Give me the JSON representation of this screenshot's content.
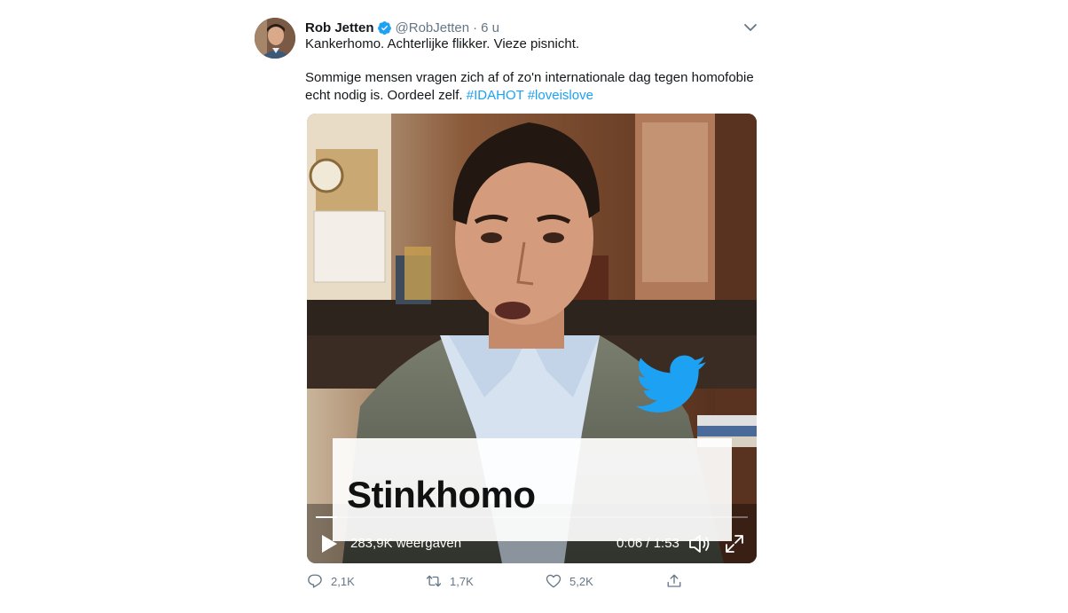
{
  "tweet": {
    "author_name": "Rob Jetten",
    "author_handle": "@RobJetten",
    "separator": "·",
    "time": "6 u",
    "text_line1": "Kankerhomo. Achterlijke flikker. Vieze pisnicht.",
    "text_line2": "Sommige mensen vragen zich af of zo'n internationale dag tegen homofobie echt nodig is. Oordeel zelf.",
    "hashtags": [
      "#IDAHOT",
      "#loveislove"
    ],
    "verified": true
  },
  "video": {
    "caption": "Stinkhomo",
    "views": "283,9K weergaven",
    "duration": "0:06 / 1:53",
    "progress": 0.05
  },
  "actions": {
    "replies": "2,1K",
    "retweets": "1,7K",
    "likes": "5,2K"
  },
  "colors": {
    "accent": "#1da1f2",
    "muted": "#657786"
  },
  "icons": [
    "verified-badge-icon",
    "chevron-down-icon",
    "twitter-bird-icon",
    "play-icon",
    "volume-icon",
    "fullscreen-icon",
    "reply-icon",
    "retweet-icon",
    "like-icon",
    "share-icon"
  ]
}
